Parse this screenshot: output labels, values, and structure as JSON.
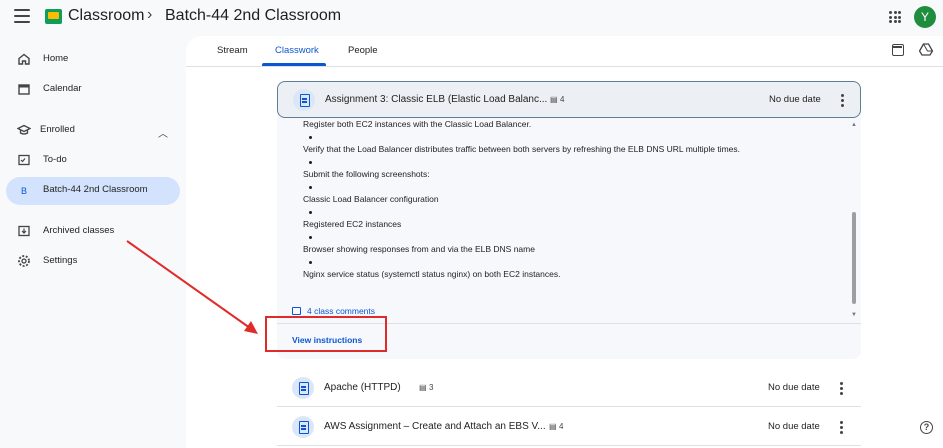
{
  "header": {
    "app_title": "Classroom",
    "separator": "›",
    "class_title": "Batch-44 2nd Classroom",
    "avatar_letter": "Y"
  },
  "sidebar": {
    "home": "Home",
    "calendar": "Calendar",
    "enrolled": "Enrolled",
    "todo": "To-do",
    "class_badge": "B",
    "class_item": "Batch-44 2nd Classroom",
    "archived": "Archived classes",
    "settings": "Settings"
  },
  "tabs": {
    "stream": "Stream",
    "classwork": "Classwork",
    "people": "People"
  },
  "expanded_assignment": {
    "title": "Assignment 3: Classic ELB (Elastic Load Balanc...",
    "attachment_count": "4",
    "due": "No due date",
    "lines": [
      "Register both EC2 instances with the Classic Load Balancer.",
      "Verify that the Load Balancer distributes traffic between both servers by refreshing the ELB DNS URL multiple times.",
      "Submit the following screenshots:",
      "Classic Load Balancer configuration",
      "Registered EC2 instances",
      "Browser showing responses from and via the ELB DNS name",
      "Nginx service status (systemctl status nginx) on both EC2 instances."
    ],
    "comments": "4 class comments",
    "view_instructions": "View instructions"
  },
  "assignments": [
    {
      "title": "Apache (HTTPD)",
      "attachment_count": "3",
      "due": "No due date"
    },
    {
      "title": "AWS Assignment – Create and Attach an EBS V...",
      "attachment_count": "4",
      "due": "No due date"
    }
  ],
  "colors": {
    "accent": "#0b57d0",
    "active_nav_bg": "#d3e3fd",
    "annotation_red": "#e02b2b"
  },
  "help_label": "?"
}
